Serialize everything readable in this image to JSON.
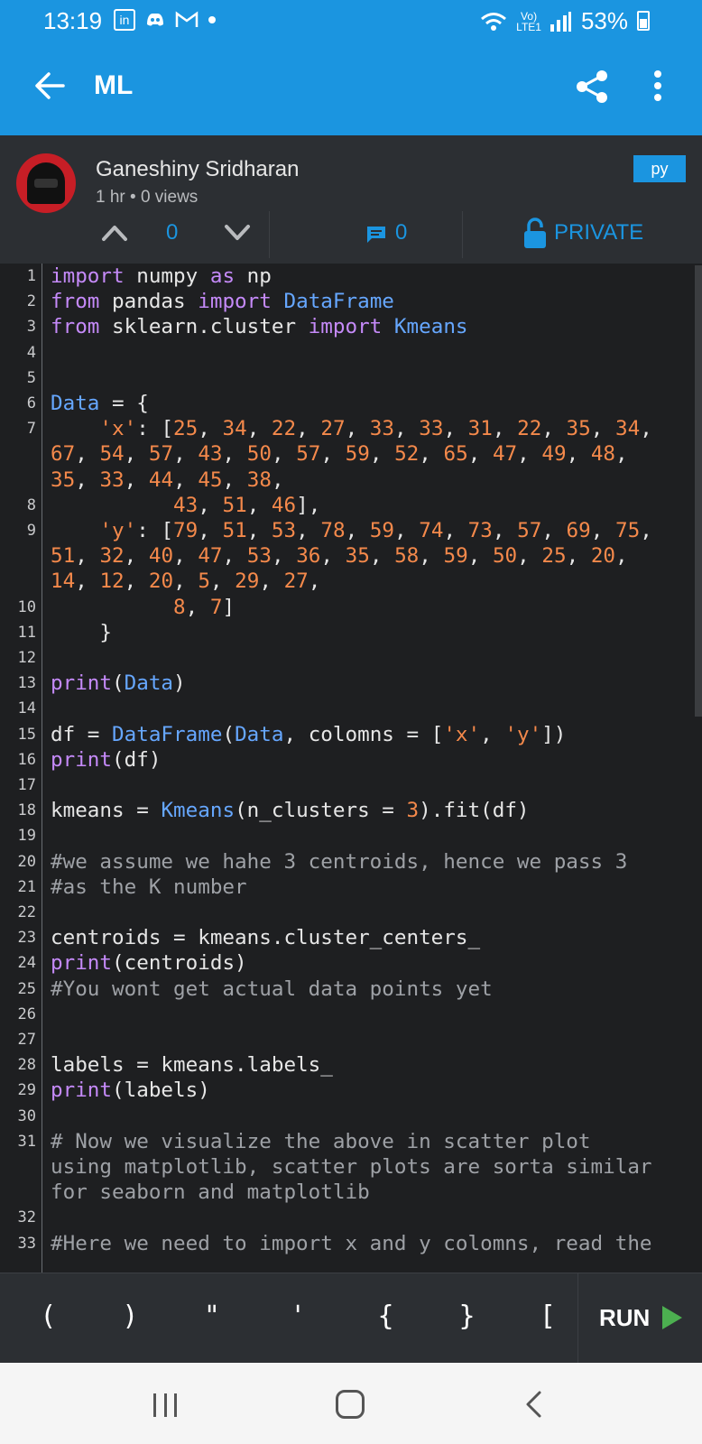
{
  "status_bar": {
    "time": "13:19",
    "notifications": [
      "linkedin-icon",
      "discord-icon",
      "gmail-icon",
      "dot"
    ],
    "network_label_top": "Vo)",
    "network_label_bottom": "LTE1",
    "battery": "53%"
  },
  "app_bar": {
    "title": "ML"
  },
  "post": {
    "author": "Ganeshiny Sridharan",
    "meta": "1 hr • 0 views",
    "language": "py",
    "votes": "0",
    "comments": "0",
    "visibility": "PRIVATE"
  },
  "code_lines": [
    {
      "n": "1",
      "html": "<span class=\"kw\">import</span> numpy <span class=\"kw\">as</span> np"
    },
    {
      "n": "2",
      "html": "<span class=\"kw\">from</span> pandas <span class=\"kw\">import</span> <span class=\"cls\">DataFrame</span>"
    },
    {
      "n": "3",
      "html": "<span class=\"kw\">from</span> sklearn.cluster <span class=\"kw\">import</span> <span class=\"cls\">Kmeans</span>"
    },
    {
      "n": "4",
      "html": ""
    },
    {
      "n": "5",
      "html": ""
    },
    {
      "n": "6",
      "html": "<span class=\"cls\">Data</span> = {"
    },
    {
      "n": "7",
      "html": "    <span class=\"str\">'x'</span>: [<span class=\"num\">25</span>, <span class=\"num\">34</span>, <span class=\"num\">22</span>, <span class=\"num\">27</span>, <span class=\"num\">33</span>, <span class=\"num\">33</span>, <span class=\"num\">31</span>, <span class=\"num\">22</span>, <span class=\"num\">35</span>, <span class=\"num\">34</span>,"
    },
    {
      "n": "",
      "html": "<span class=\"num\">67</span>, <span class=\"num\">54</span>, <span class=\"num\">57</span>, <span class=\"num\">43</span>, <span class=\"num\">50</span>, <span class=\"num\">57</span>, <span class=\"num\">59</span>, <span class=\"num\">52</span>, <span class=\"num\">65</span>, <span class=\"num\">47</span>, <span class=\"num\">49</span>, <span class=\"num\">48</span>,"
    },
    {
      "n": "",
      "html": "<span class=\"num\">35</span>, <span class=\"num\">33</span>, <span class=\"num\">44</span>, <span class=\"num\">45</span>, <span class=\"num\">38</span>,"
    },
    {
      "n": "8",
      "html": "          <span class=\"num\">43</span>, <span class=\"num\">51</span>, <span class=\"num\">46</span>],"
    },
    {
      "n": "9",
      "html": "    <span class=\"str\">'y'</span>: [<span class=\"num\">79</span>, <span class=\"num\">51</span>, <span class=\"num\">53</span>, <span class=\"num\">78</span>, <span class=\"num\">59</span>, <span class=\"num\">74</span>, <span class=\"num\">73</span>, <span class=\"num\">57</span>, <span class=\"num\">69</span>, <span class=\"num\">75</span>,"
    },
    {
      "n": "",
      "html": "<span class=\"num\">51</span>, <span class=\"num\">32</span>, <span class=\"num\">40</span>, <span class=\"num\">47</span>, <span class=\"num\">53</span>, <span class=\"num\">36</span>, <span class=\"num\">35</span>, <span class=\"num\">58</span>, <span class=\"num\">59</span>, <span class=\"num\">50</span>, <span class=\"num\">25</span>, <span class=\"num\">20</span>,"
    },
    {
      "n": "",
      "html": "<span class=\"num\">14</span>, <span class=\"num\">12</span>, <span class=\"num\">20</span>, <span class=\"num\">5</span>, <span class=\"num\">29</span>, <span class=\"num\">27</span>,"
    },
    {
      "n": "10",
      "html": "          <span class=\"num\">8</span>, <span class=\"num\">7</span>]"
    },
    {
      "n": "11",
      "html": "    }"
    },
    {
      "n": "12",
      "html": ""
    },
    {
      "n": "13",
      "html": "<span class=\"fn\">print</span>(<span class=\"cls\">Data</span>)"
    },
    {
      "n": "14",
      "html": ""
    },
    {
      "n": "15",
      "html": "df = <span class=\"cls\">DataFrame</span>(<span class=\"cls\">Data</span>, colomns = [<span class=\"str\">'x'</span>, <span class=\"str\">'y'</span>])"
    },
    {
      "n": "16",
      "html": "<span class=\"fn\">print</span>(df)"
    },
    {
      "n": "17",
      "html": ""
    },
    {
      "n": "18",
      "html": "kmeans = <span class=\"cls\">Kmeans</span>(n_clusters = <span class=\"num\">3</span>).fit(df)"
    },
    {
      "n": "19",
      "html": ""
    },
    {
      "n": "20",
      "html": "<span class=\"cm\">#we assume we hahe 3 centroids, hence we pass 3</span>"
    },
    {
      "n": "21",
      "html": "<span class=\"cm\">#as the K number</span>"
    },
    {
      "n": "22",
      "html": ""
    },
    {
      "n": "23",
      "html": "centroids = kmeans.cluster_centers_"
    },
    {
      "n": "24",
      "html": "<span class=\"fn\">print</span>(centroids)"
    },
    {
      "n": "25",
      "html": "<span class=\"cm\">#You wont get actual data points yet</span>"
    },
    {
      "n": "26",
      "html": ""
    },
    {
      "n": "27",
      "html": ""
    },
    {
      "n": "28",
      "html": "labels = kmeans.labels_"
    },
    {
      "n": "29",
      "html": "<span class=\"fn\">print</span>(labels)"
    },
    {
      "n": "30",
      "html": ""
    },
    {
      "n": "31",
      "html": "<span class=\"cm\"># Now we visualize the above in scatter plot</span>"
    },
    {
      "n": "",
      "html": "<span class=\"cm\">using matplotlib, scatter plots are sorta similar</span>"
    },
    {
      "n": "",
      "html": "<span class=\"cm\">for seaborn and matplotlib</span>"
    },
    {
      "n": "32",
      "html": ""
    },
    {
      "n": "33",
      "html": "<span class=\"cm\">#Here we need to import x and y colomns, read the</span>"
    }
  ],
  "keybar": {
    "keys": [
      "(",
      ")",
      "\"",
      "'",
      "{",
      "}",
      "["
    ],
    "run_label": "RUN"
  },
  "colors": {
    "accent": "#1b95e0",
    "run_green": "#4caf50"
  }
}
